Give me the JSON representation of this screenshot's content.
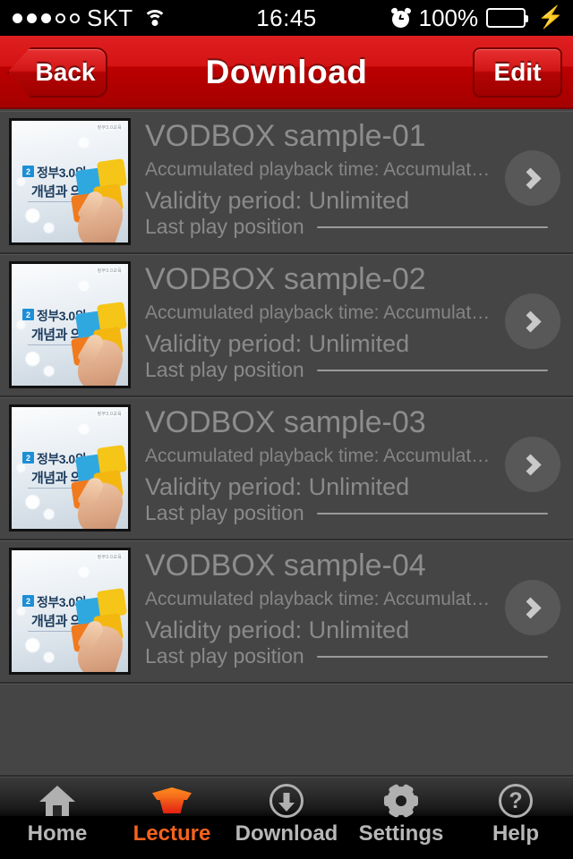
{
  "status_bar": {
    "carrier": "SKT",
    "signal_dots_filled": 3,
    "signal_dots_total": 5,
    "wifi_icon": "wifi-icon",
    "time": "16:45",
    "alarm_icon": "alarm-clock-icon",
    "battery_percent": "100%",
    "battery_level": 100,
    "battery_color": "#35d64a",
    "charging_icon": "lightning-bolt-icon"
  },
  "navbar": {
    "back_label": "Back",
    "title": "Download",
    "edit_label": "Edit",
    "accent_color": "#c00000"
  },
  "list": {
    "rows": [
      {
        "title": "VODBOX sample-01",
        "accumulated": "Accumulated playback time: Accumulat…",
        "validity": "Validity period: Unlimited",
        "last_play_label": "Last play position",
        "thumbnail": {
          "badge": "2",
          "line1": "정부3.0의",
          "line2": "개념과 의의",
          "corner_tag": "정부3.0교육"
        }
      },
      {
        "title": "VODBOX sample-02",
        "accumulated": "Accumulated playback time: Accumulat…",
        "validity": "Validity period: Unlimited",
        "last_play_label": "Last play position",
        "thumbnail": {
          "badge": "2",
          "line1": "정부3.0의",
          "line2": "개념과 의의",
          "corner_tag": "정부3.0교육"
        }
      },
      {
        "title": "VODBOX sample-03",
        "accumulated": "Accumulated playback time: Accumulat…",
        "validity": "Validity period: Unlimited",
        "last_play_label": "Last play position",
        "thumbnail": {
          "badge": "2",
          "line1": "정부3.0의",
          "line2": "개념과 의의",
          "corner_tag": "정부3.0교육"
        }
      },
      {
        "title": "VODBOX sample-04",
        "accumulated": "Accumulated playback time: Accumulat…",
        "validity": "Validity period: Unlimited",
        "last_play_label": "Last play position",
        "thumbnail": {
          "badge": "2",
          "line1": "정부3.0의",
          "line2": "개념과 의의",
          "corner_tag": "정부3.0교육"
        }
      }
    ],
    "disclosure_icon": "chevron-right-icon",
    "text_color": "#8a8a8a",
    "background_color": "#454545"
  },
  "tabbar": {
    "active_color": "#f4631e",
    "inactive_color": "#b7b7b7",
    "items": [
      {
        "label": "Home",
        "icon": "home-icon",
        "active": false
      },
      {
        "label": "Lecture",
        "icon": "graduation-cap-icon",
        "active": true
      },
      {
        "label": "Download",
        "icon": "download-circle-icon",
        "active": false
      },
      {
        "label": "Settings",
        "icon": "gear-icon",
        "active": false
      },
      {
        "label": "Help",
        "icon": "question-mark-circle-icon",
        "active": false
      }
    ]
  }
}
